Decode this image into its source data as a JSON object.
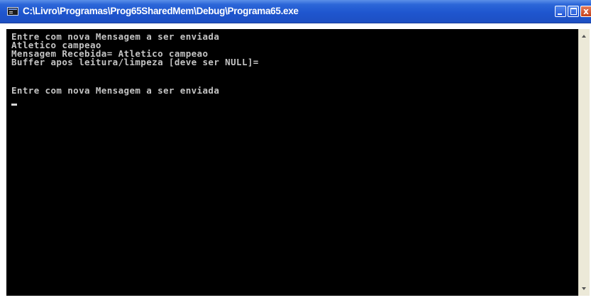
{
  "window": {
    "title": "C:\\Livro\\Programas\\Prog65SharedMem\\Debug\\Programa65.exe",
    "close_label": "x"
  },
  "console": {
    "lines": [
      "Entre com nova Mensagem a ser enviada",
      "Atletico campeao",
      "Mensagem Recebida= Atletico campeao",
      "Buffer apos leitura/limpeza [deve ser NULL]=",
      "",
      "Entre com nova Mensagem a ser enviada"
    ],
    "text_color": "#c4c4c4",
    "background_color": "#000000"
  },
  "colors": {
    "titlebar": "#1f56cf",
    "close_button": "#c4421a"
  },
  "icons": {
    "app": "console-app-icon",
    "minimize": "minimize-icon",
    "maximize": "maximize-icon",
    "close": "close-icon",
    "scroll_up": "scroll-up-arrow-icon",
    "scroll_down": "scroll-down-arrow-icon"
  }
}
